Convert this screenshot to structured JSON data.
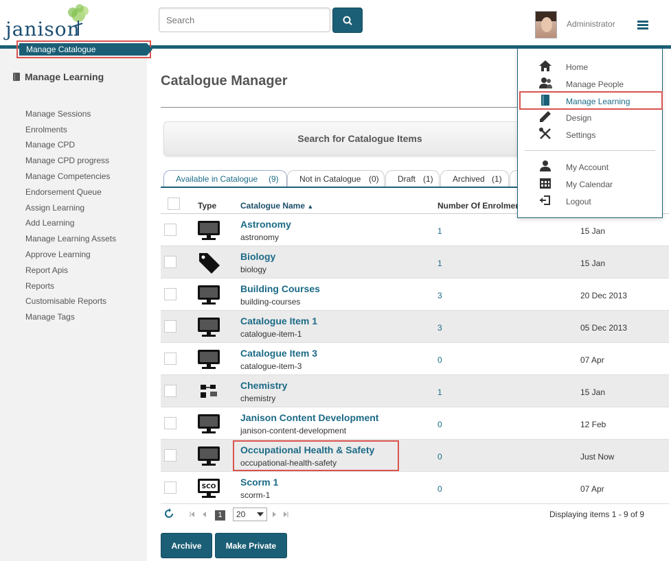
{
  "header": {
    "logo_text": "janison",
    "search_placeholder": "Search",
    "user_name": "Administrator"
  },
  "sidebar": {
    "title": "Manage Learning",
    "items": [
      "Manage Catalogue",
      "Manage Sessions",
      "Enrolments",
      "Manage CPD",
      "Manage CPD progress",
      "Manage Competencies",
      "Endorsement Queue",
      "Assign Learning",
      "Add Learning",
      "Manage Learning Assets",
      "Approve Learning",
      "Report Apis",
      "Reports",
      "Customisable Reports",
      "Manage Tags"
    ]
  },
  "main": {
    "title": "Catalogue Manager",
    "search_button": "Search for Catalogue Items",
    "tabs": [
      {
        "label": "Available in Catalogue",
        "count": "(9)"
      },
      {
        "label": "Not in Catalogue",
        "count": "(0)"
      },
      {
        "label": "Draft",
        "count": "(1)"
      },
      {
        "label": "Archived",
        "count": "(1)"
      }
    ],
    "columns": {
      "type": "Type",
      "name": "Catalogue Name",
      "sort_glyph": "▲",
      "enrolments": "Number Of Enrolments"
    },
    "rows": [
      {
        "name": "Astronomy",
        "slug": "astronomy",
        "enrolments": "1",
        "date": "15 Jan",
        "icon": "monitor-icon"
      },
      {
        "name": "Biology",
        "slug": "biology",
        "enrolments": "1",
        "date": "15 Jan",
        "icon": "tag-icon"
      },
      {
        "name": "Building Courses",
        "slug": "building-courses",
        "enrolments": "3",
        "date": "20 Dec 2013",
        "icon": "monitor-icon"
      },
      {
        "name": "Catalogue Item 1",
        "slug": "catalogue-item-1",
        "enrolments": "3",
        "date": "05 Dec 2013",
        "icon": "monitor-icon"
      },
      {
        "name": "Catalogue Item 3",
        "slug": "catalogue-item-3",
        "enrolments": "0",
        "date": "07 Apr",
        "icon": "monitor-icon"
      },
      {
        "name": "Chemistry",
        "slug": "chemistry",
        "enrolments": "1",
        "date": "15 Jan",
        "icon": "blended-icon"
      },
      {
        "name": "Janison Content Development",
        "slug": "janison-content-development",
        "enrolments": "0",
        "date": "12 Feb",
        "icon": "monitor-icon"
      },
      {
        "name": "Occupational Health & Safety",
        "slug": "occupational-health-safety",
        "enrolments": "0",
        "date": "Just Now",
        "icon": "monitor-icon"
      },
      {
        "name": "Scorm 1",
        "slug": "scorm-1",
        "enrolments": "0",
        "date": "07 Apr",
        "icon": "scorm-icon"
      }
    ],
    "scorm_label": "SCO",
    "pager": {
      "current_page": "1",
      "page_size": "20",
      "display_text": "Displaying items 1 - 9 of 9"
    },
    "buttons": {
      "archive": "Archive",
      "make_private": "Make Private"
    }
  },
  "menu": {
    "items": [
      {
        "label": "Home",
        "icon": "home-icon"
      },
      {
        "label": "Manage People",
        "icon": "people-icon"
      },
      {
        "label": "Manage Learning",
        "icon": "book-icon"
      },
      {
        "label": "Design",
        "icon": "pencil-icon"
      },
      {
        "label": "Settings",
        "icon": "tools-icon"
      }
    ],
    "account_items": [
      {
        "label": "My Account",
        "icon": "user-icon"
      },
      {
        "label": "My Calendar",
        "icon": "calendar-icon"
      },
      {
        "label": "Logout",
        "icon": "logout-icon"
      }
    ]
  },
  "colors": {
    "accent": "#1b5f76",
    "highlight": "#d9534f",
    "link": "#1b6a86"
  }
}
